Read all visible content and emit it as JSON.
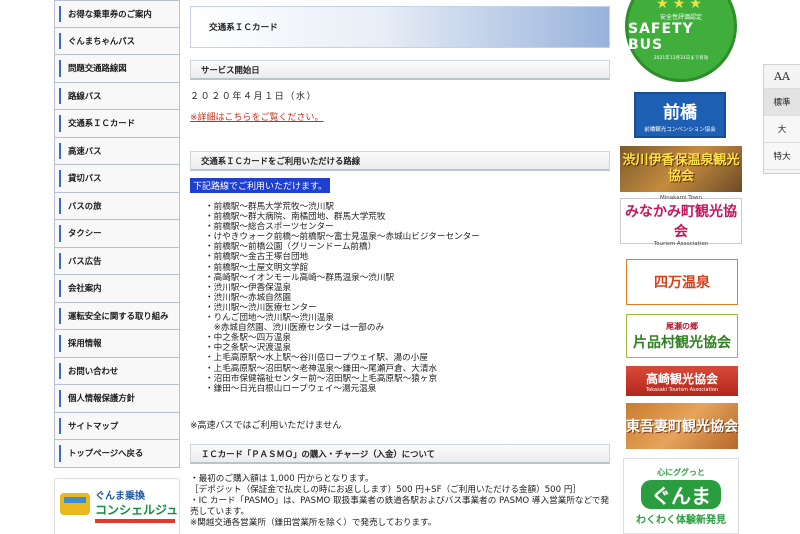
{
  "sidebar": {
    "items": [
      "お得な乗車券のご案内",
      "ぐんまちゃんパス",
      "問題交通路線図",
      "路線バス",
      "交通系ＩＣカード",
      "高速バス",
      "貸切バス",
      "バスの旅",
      "タクシー",
      "バス広告",
      "会社案内",
      "運転安全に関する取り組み",
      "採用情報",
      "お問い合わせ",
      "個人情報保護方針",
      "サイトマップ",
      "トップページへ戻る"
    ],
    "banner": {
      "line1": "ぐんま乗換",
      "line2": "コンシェルジュ"
    }
  },
  "main": {
    "page_title": "交通系ＩＣカード",
    "section1_title": "サービス開始日",
    "start_date": "２０２０年４月１日（水）",
    "detail_link": "※詳細はこちらをご覧ください。",
    "section2_title": "交通系ＩＣカードをご利用いただける路線",
    "routes_intro": "下記路線でご利用いただけます。",
    "routes": [
      "・前橋駅～群馬大学荒牧～渋川駅",
      "・前橋駅～群大病院、南橘団地、群馬大学荒牧",
      "・前橋駅～総合スポーツセンター",
      "・けやきウォーク前橋～前橋駅～富士見温泉～赤城山ビジターセンター",
      "・前橋駅～前橋公園（グリーンドーム前橋）",
      "・前橋駅～金古王塚台団地",
      "・前橋駅～土屋文明文学館",
      "・高崎駅～イオンモール高崎～群馬温泉～渋川駅",
      "・渋川駅～伊香保温泉",
      "・渋川駅～赤城自然園",
      "・渋川駅～渋川医療センター",
      "・りんご団地～渋川駅～渋川温泉",
      "　※赤城自然園、渋川医療センターは一部のみ",
      "・中之条駅～四万温泉",
      "・中之条駅～沢渡温泉",
      "・上毛高原駅～水上駅～谷川岳ロープウェイ駅、湯の小屋",
      "・上毛高原駅～沼田駅～老神温泉～鎌田～尾瀬戸倉、大清水",
      "・沼田市保健福祉センター前～沼田駅～上毛高原駅～猿ヶ京",
      "・鎌田～日光白根山ロープウェイ～湯元温泉"
    ],
    "highway_note": "※高速バスではご利用いただけません",
    "section3_title": "ＩＣカード「ＰＡＳＭＯ」の購入・チャージ（入金）について",
    "pasmo": [
      "・最初のご購入額は 1,000 円からとなります。",
      "［デポジット（保証金で払戻しの時にお返しします）500 円+SF（ご利用いただける金額）500 円］",
      "・IC カード「PASMO」は、PASMO 取扱事業者の鉄道各駅およびバス事業者の PASMO 導入営業所などで発売しています。",
      "※関越交通各営業所（鎌田営業所を除く）で発売しております。"
    ]
  },
  "right": {
    "safety": {
      "top": "安全性評価認定",
      "main": "SAFETY BUS",
      "sub": "2021年12月31日まで有効"
    },
    "maebashi": {
      "main": "前橋",
      "sub": "前橋観光コンベンション協会"
    },
    "ikaho": "渋川伊香保温泉観光協会",
    "minakami": {
      "top": "Minakami Town",
      "main": "みなかみ町観光協会",
      "sub": "Tourism Association"
    },
    "shima": "四万温泉",
    "oze": {
      "top": "尾瀬の郷",
      "main": "片品村観光協会"
    },
    "takasaki": {
      "main": "高崎観光協会",
      "sub": "Takasaki Tourism Association"
    },
    "higashiagatsuma": "東吾妻町観光協会",
    "gunma": {
      "top": "心にググっと",
      "main": "ぐんま",
      "sub": "わくわく体験新発見"
    }
  },
  "font_widget": {
    "icon": "AA",
    "normal": "標準",
    "large": "大",
    "xlarge": "特大"
  }
}
